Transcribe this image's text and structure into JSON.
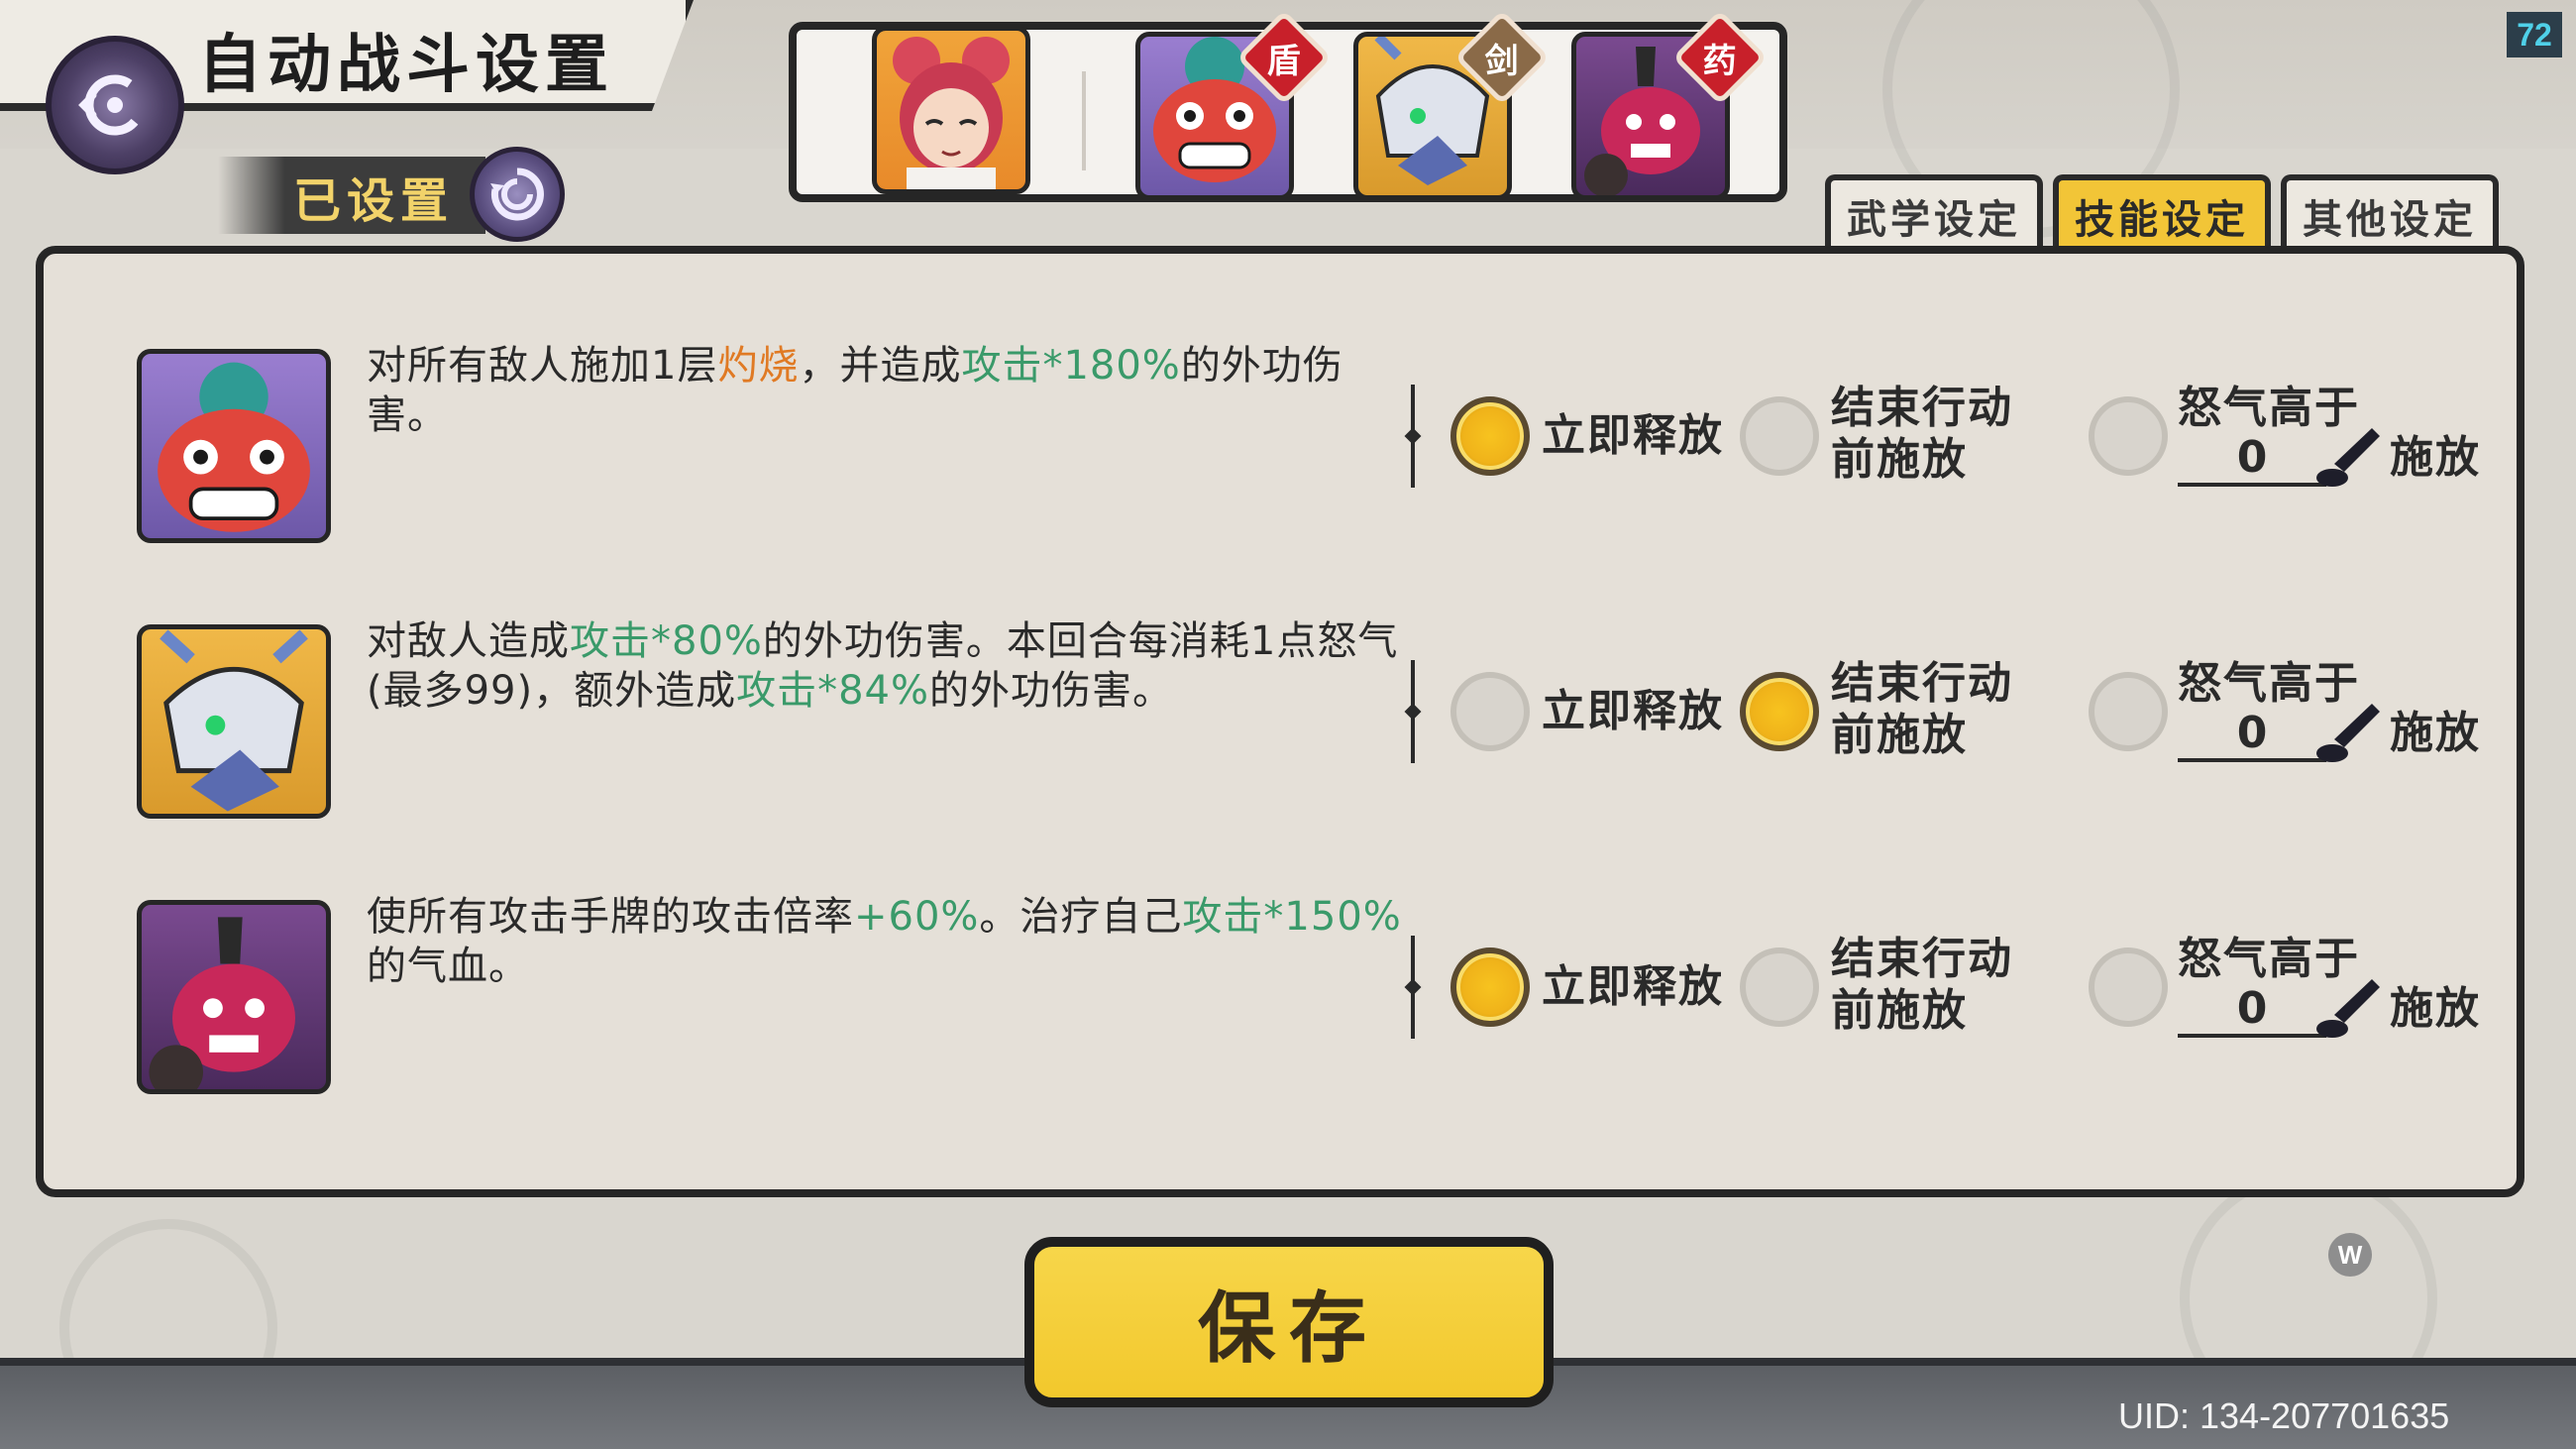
{
  "header": {
    "title": "自动战斗设置",
    "status": "已设置",
    "fps": "72"
  },
  "team": [
    {
      "name": "portrait-girl",
      "badge": ""
    },
    {
      "name": "portrait-lion-dancer",
      "badge": "盾"
    },
    {
      "name": "portrait-masked-warrior",
      "badge": "剑"
    },
    {
      "name": "portrait-red-beast",
      "badge": "药"
    }
  ],
  "tabs": [
    {
      "label": "武学设定",
      "active": false
    },
    {
      "label": "技能设定",
      "active": true
    },
    {
      "label": "其他设定",
      "active": false
    }
  ],
  "skills": [
    {
      "desc_parts": [
        {
          "t": "对所有敌人施加1层",
          "c": ""
        },
        {
          "t": "灼烧",
          "c": "o"
        },
        {
          "t": "，并造成",
          "c": ""
        },
        {
          "t": "攻击*180%",
          "c": "g"
        },
        {
          "t": "的外功伤害。",
          "c": ""
        }
      ],
      "selected": 0
    },
    {
      "desc_parts": [
        {
          "t": "对敌人造成",
          "c": ""
        },
        {
          "t": "攻击*80%",
          "c": "g"
        },
        {
          "t": "的外功伤害。本回合每消耗1点怒气(最多99)，额外造成",
          "c": ""
        },
        {
          "t": "攻击*84%",
          "c": "g"
        },
        {
          "t": "的外功伤害。",
          "c": ""
        }
      ],
      "selected": 1
    },
    {
      "desc_parts": [
        {
          "t": "使所有攻击手牌的攻击倍率",
          "c": ""
        },
        {
          "t": "+60%",
          "c": "g"
        },
        {
          "t": "。治疗自己",
          "c": ""
        },
        {
          "t": "攻击*150%",
          "c": "g"
        },
        {
          "t": "的气血。",
          "c": ""
        }
      ],
      "selected": 0
    }
  ],
  "options": {
    "immediate": "立即释放",
    "before_end_line1": "结束行动",
    "before_end_line2": "前施放",
    "rage_line1": "怒气高于",
    "rage_value": "0",
    "rage_suffix": "施放"
  },
  "footer": {
    "save_label": "保存",
    "uid": "UID: 134-207701635",
    "w_badge": "W"
  },
  "colors": {
    "accent": "#f2c537",
    "highlight_green": "#3a9a6a",
    "highlight_orange": "#e07a24",
    "panel": "#e5e0d8"
  }
}
